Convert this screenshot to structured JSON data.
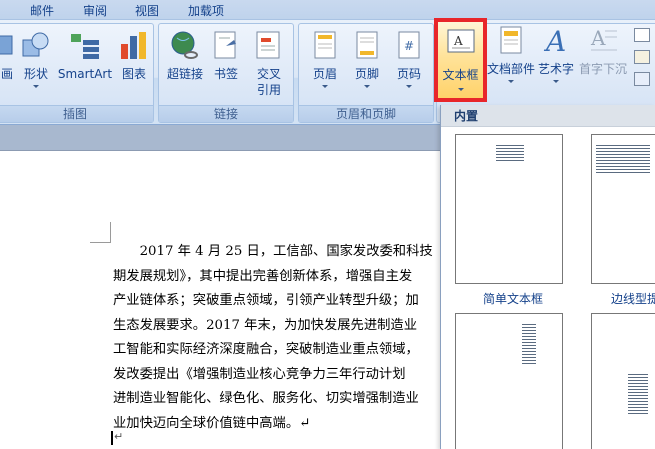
{
  "menu_tabs": [
    "邮件",
    "审阅",
    "视图",
    "加载项"
  ],
  "ribbon": {
    "groups": [
      {
        "title": "插图"
      },
      {
        "title": "链接"
      },
      {
        "title": "页眉和页脚"
      }
    ],
    "buttons": {
      "picture_partial": "画",
      "shape": "形状",
      "smartart": "SmartArt",
      "chart": "图表",
      "hyperlink": "超链接",
      "bookmark": "书签",
      "crossref_1": "交叉",
      "crossref_2": "引用",
      "header": "页眉",
      "footer": "页脚",
      "page_number": "页码",
      "textbox": "文本框",
      "quick_parts": "文档部件",
      "wordart": "艺术字",
      "drop_cap": "首字下沉"
    }
  },
  "document": {
    "lines": [
      "　　2017 年 4 月 25 日，工信部、国家发改委和科技",
      "期发展规划》，其中提出完善创新体系，增强自主发",
      "产业链体系；突破重点领域，引领产业转型升级；加",
      "生态发展要求。2017 年末，为加快发展先进制造业",
      "工智能和实际经济深度融合，突破制造业重点领域，",
      "发改委提出《增强制造业核心竞争力三年行动计划",
      "进制造业智能化、绿色化、服务化、切实增强制造业",
      "业加快迈向全球价值链中高端。↵"
    ],
    "end_mark": "↵"
  },
  "gallery": {
    "section_title": "内置",
    "items": [
      {
        "label": "简单文本框"
      },
      {
        "label": "边线型提要栏"
      }
    ]
  },
  "colors": {
    "highlight_border": "#e8262a",
    "ribbon_text": "#15428b"
  }
}
